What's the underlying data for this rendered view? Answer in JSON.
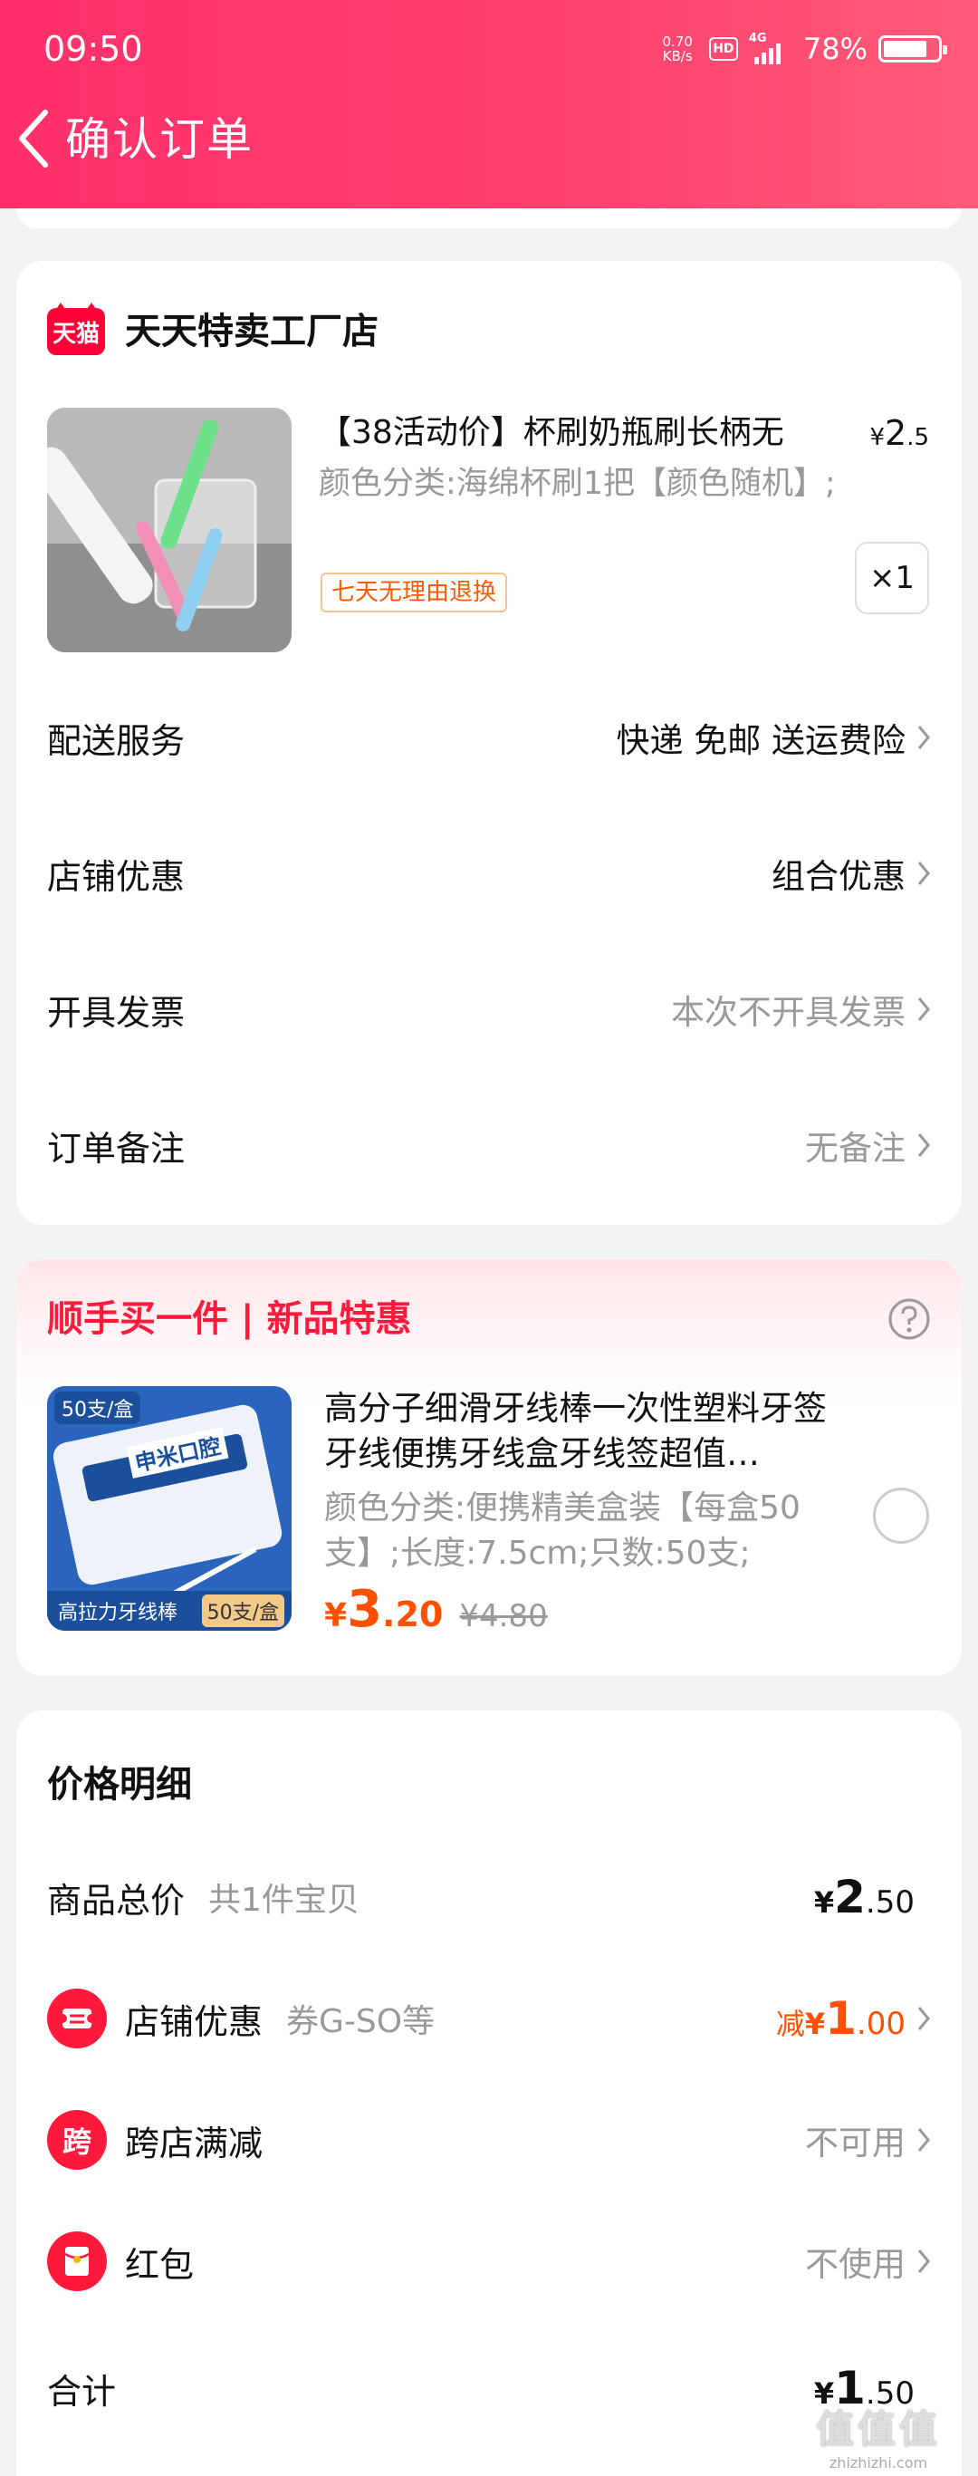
{
  "status_bar": {
    "time": "09:50",
    "netspeed_value": "0.70",
    "netspeed_unit": "KB/s",
    "hd": "HD",
    "network": "4G",
    "battery": "78%"
  },
  "header": {
    "title": "确认订单"
  },
  "shop": {
    "logo_text": "天猫",
    "name": "天天特卖工厂店",
    "product": {
      "title": "【38活动价】杯刷奶瓶刷长柄无",
      "price_symbol": "¥",
      "price_int": "2",
      "price_dec": ".5",
      "spec": "颜色分类:海绵杯刷1把【颜色随机】;",
      "badge": "七天无理由退换",
      "quantity": "×1"
    },
    "rows": [
      {
        "label": "配送服务",
        "value": "快递 免邮 送运费险",
        "gray": false
      },
      {
        "label": "店铺优惠",
        "value": "组合优惠",
        "gray": false
      },
      {
        "label": "开具发票",
        "value": "本次不开具发票",
        "gray": true
      },
      {
        "label": "订单备注",
        "value": "无备注",
        "gray": true
      }
    ]
  },
  "recommend": {
    "title": "顺手买一件 | 新品特惠",
    "thumb_tag": "50支/盒",
    "thumb_brand": "申米口腔",
    "thumb_bottom": "高拉力牙线棒",
    "thumb_bottom_tag": "50支/盒",
    "name": "高分子细滑牙线棒一次性塑料牙签牙线便携牙线盒牙线签超值…",
    "spec": "颜色分类:便携精美盒装【每盒50支】;长度:7.5cm;只数:50支;",
    "price_symbol": "¥",
    "price_int": "3",
    "price_dec": ".20",
    "old_price": "¥4.80"
  },
  "price_detail": {
    "title": "价格明细",
    "goods_total": {
      "label": "商品总价",
      "sub": "共1件宝贝",
      "symbol": "¥",
      "int": "2",
      "dec": ".50"
    },
    "shop_discount": {
      "label": "店铺优惠",
      "sub": "券G-SO等",
      "reduce": "减",
      "symbol": "¥",
      "int": "1",
      "dec": ".00"
    },
    "cross_store": {
      "icon_text": "跨",
      "label": "跨店满减",
      "value": "不可用"
    },
    "red_packet": {
      "label": "红包",
      "value": "不使用"
    },
    "total": {
      "label": "合计",
      "symbol": "¥",
      "int": "1",
      "dec": ".50"
    }
  },
  "watermark": {
    "top": "值值值",
    "bottom": "zhizhizhi.com"
  },
  "colors": {
    "brand_red": "#ff1a3c",
    "header_pink": "#ff3f6d",
    "price_orange": "#ff5000"
  }
}
